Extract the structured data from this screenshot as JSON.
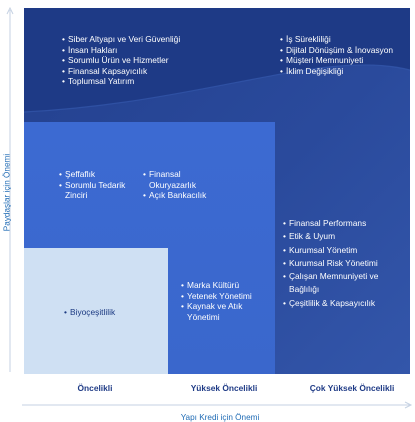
{
  "chart_data": {
    "type": "table",
    "xlabel": "Yapı Kredi için Önemi",
    "ylabel": "Paydaşlar için Önemi",
    "columns": [
      "Öncelikli",
      "Yüksek Öncelikli",
      "Çok Yüksek Öncelikli"
    ],
    "cells": {
      "very_high_left": [
        "Siber Altyapı ve Veri Güvenliği",
        "İnsan Hakları",
        "Sorumlu Ürün ve Hizmetler",
        "Finansal Kapsayıcılık",
        "Toplumsal Yatırım"
      ],
      "very_high_right": [
        "İş Sürekliliği",
        "Dijital Dönüşüm & İnovasyon",
        "Müşteri Memnuniyeti",
        "İklim Değişikliği"
      ],
      "high_left": [
        "Şeffaflık",
        "Sorumlu Tedarik Zinciri"
      ],
      "high_middle": [
        "Finansal Okuryazarlık",
        "Açık Bankacılık"
      ],
      "right_column": [
        "Finansal Performans",
        "Etik & Uyum",
        "Kurumsal Yönetim",
        "Kurumsal Risk Yönetimi",
        "Çalışan Memnuniyeti ve Bağlılığı",
        "Çeşitlilik & Kapsayıcılık"
      ],
      "middle_bottom": [
        "Marka Kültürü",
        "Yetenek Yönetimi",
        "Kaynak ve Atık Yönetimi"
      ],
      "low_left": [
        "Biyoçeşitlilik"
      ]
    }
  },
  "colors": {
    "background": "#23408e",
    "high_zone": "#3c6ad2",
    "low_zone": "#cfe0f3",
    "labels": "#1f3b86",
    "axis_title": "#1f6bb5"
  }
}
